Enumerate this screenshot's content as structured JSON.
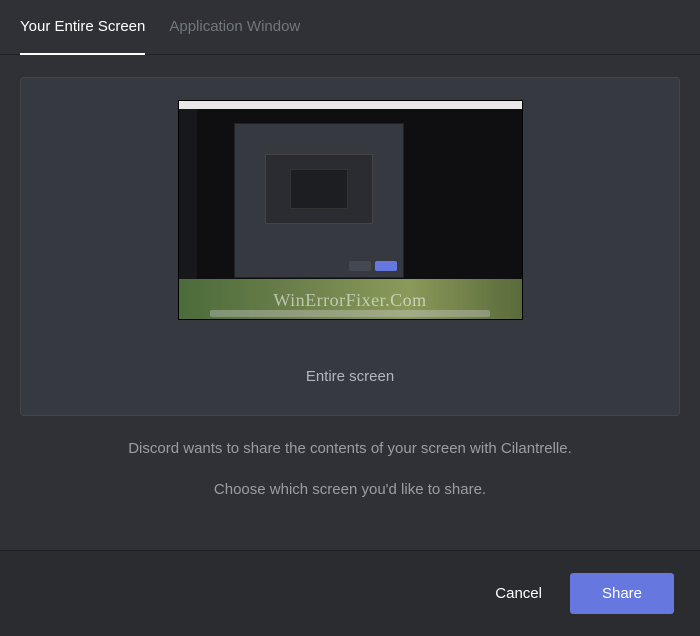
{
  "tabs": {
    "entire_screen": "Your Entire Screen",
    "application_window": "Application Window"
  },
  "screen": {
    "label": "Entire screen",
    "watermark": "WinErrorFixer.Com"
  },
  "info": {
    "line1": "Discord wants to share the contents of your screen with Cilantrelle.",
    "line2": "Choose which screen you'd like to share."
  },
  "buttons": {
    "cancel": "Cancel",
    "share": "Share"
  }
}
